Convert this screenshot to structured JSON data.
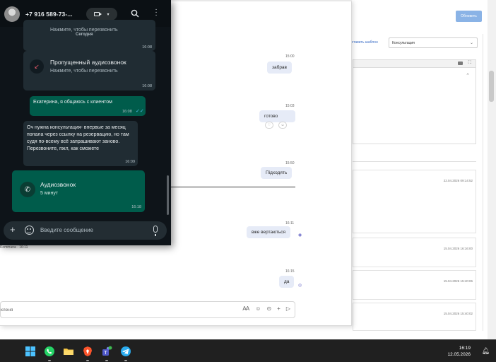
{
  "right_app": {
    "refresh_button": "Обновить",
    "template_link": "вставить шаблон",
    "template_select_value": "Консультация",
    "timestamps": [
      "22.04.2026 09:14:52",
      "15.04.2026 16:16:00",
      "15.04.2026 15:40:06",
      "15.04.2026 15:40:02"
    ]
  },
  "browser_chat": {
    "messages": [
      {
        "time": "15:00",
        "text": "забрав"
      },
      {
        "time": "15:03",
        "text": "готово"
      },
      {
        "time": "15:50",
        "text": "Підходять"
      },
      {
        "time": "16:11",
        "text": "вже вертаються"
      },
      {
        "time": "16:15",
        "text": "да"
      }
    ],
    "agent_line": "Kommuna · 16:11",
    "composer_placeholder": "кленя"
  },
  "whatsapp": {
    "contact_name": "+7 916 589-73-...",
    "colors": {
      "outgoing": "#005c4b",
      "incoming": "#202c33",
      "missed": "#f15c6d"
    },
    "cut_subtitle": "Нажмите, чтобы перезвонить",
    "date_separator": "Сегодня",
    "cut_time": "16:08",
    "missed_call": {
      "title": "Пропущенный аудиозвонок",
      "subtitle": "Нажмите, чтобы перезвонить",
      "time": "16:08"
    },
    "out_msg_1": {
      "text": "Екатерина, я общаюсь с клиентом",
      "time": "16:08"
    },
    "in_msg_1": {
      "text": "Оч нужна консультация- впервые за месяц попала через ссылку на резервацию, но там судя по-всему всё запрашивают заново. Перезвоните, пжл, как сможете",
      "time": "16:09"
    },
    "audio_call": {
      "title": "Аудиозвонок",
      "duration": "5 минут",
      "time": "16:18"
    },
    "input_placeholder": "Введите сообщение"
  },
  "taskbar": {
    "time": "16:19",
    "date": "12.05.2026"
  }
}
